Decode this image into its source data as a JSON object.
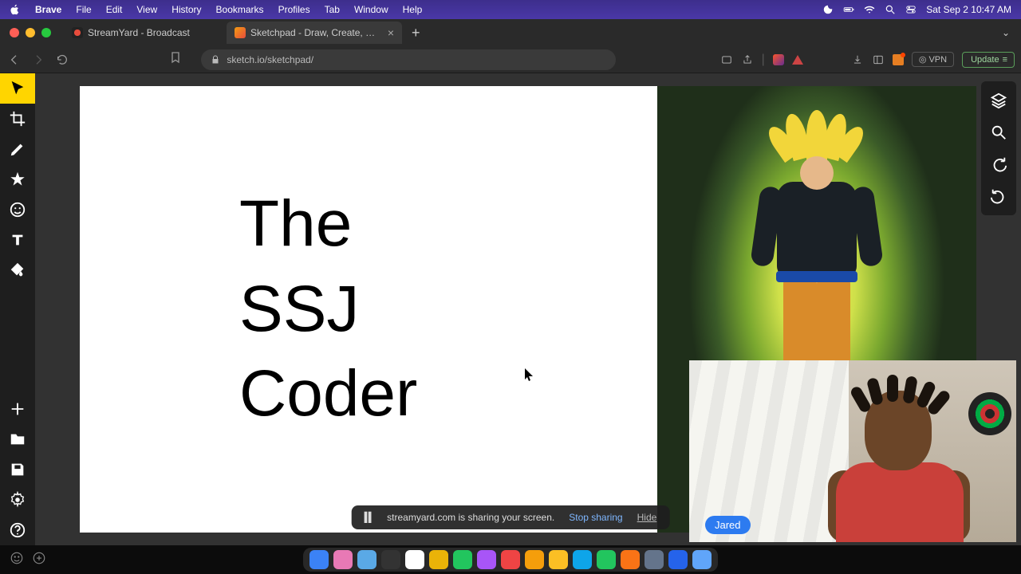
{
  "menubar": {
    "app_name": "Brave",
    "items": [
      "File",
      "Edit",
      "View",
      "History",
      "Bookmarks",
      "Profiles",
      "Tab",
      "Window",
      "Help"
    ],
    "clock": "Sat Sep 2  10:47 AM"
  },
  "browser": {
    "tabs": [
      {
        "label": "StreamYard - Broadcast",
        "active": false
      },
      {
        "label": "Sketchpad - Draw, Create, Sha",
        "active": true
      }
    ],
    "url": "sketch.io/sketchpad/",
    "vpn_label": "VPN",
    "update_label": "Update"
  },
  "sketchpad": {
    "tools_left": [
      "pointer",
      "crop",
      "brush",
      "star",
      "emoji",
      "text",
      "fill",
      "add",
      "folder",
      "save",
      "settings",
      "help"
    ],
    "tools_right": [
      "layers",
      "zoom",
      "redo",
      "undo"
    ],
    "canvas_text": {
      "line1": "The",
      "line2": "SSJ",
      "line3": "Coder"
    }
  },
  "share_notice": {
    "text": "streamyard.com is sharing your screen.",
    "stop": "Stop sharing",
    "hide": "Hide"
  },
  "webcam": {
    "name": "Jared"
  },
  "dock_colors": [
    "#3b82f6",
    "#e879b5",
    "#5aa9e6",
    "#333",
    "#fff",
    "#eab308",
    "#22c55e",
    "#a855f7",
    "#ef4444",
    "#f59e0b",
    "#fbbf24",
    "#0ea5e9",
    "#22c55e",
    "#f97316",
    "#64748b",
    "#2563eb",
    "#60a5fa"
  ]
}
